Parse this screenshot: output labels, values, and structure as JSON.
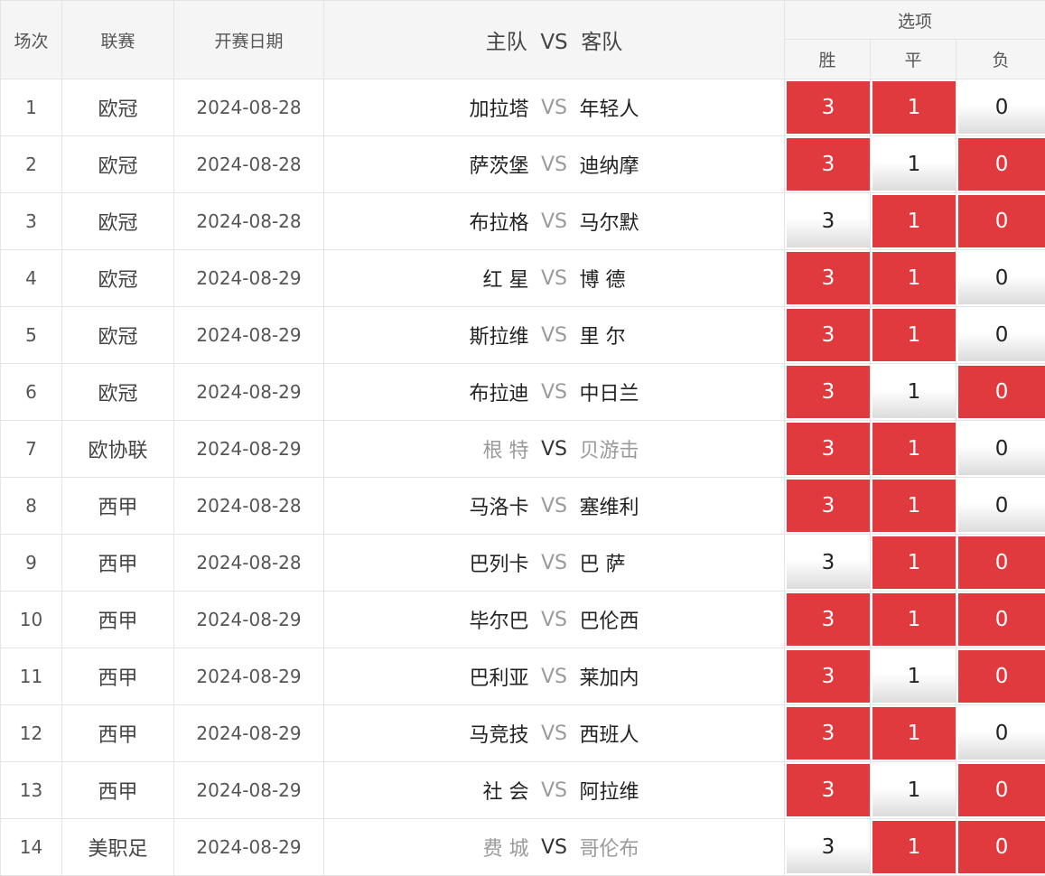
{
  "header": {
    "idx": "场次",
    "league": "联赛",
    "date": "开赛日期",
    "match_home": "主队",
    "match_vs": "VS",
    "match_away": "客队",
    "options": "选项",
    "opt_win": "胜",
    "opt_draw": "平",
    "opt_loss": "负"
  },
  "colors": {
    "selected": "#e0393e",
    "unselected": "#ffffff"
  },
  "rows": [
    {
      "idx": "1",
      "league": "欧冠",
      "date": "2024-08-28",
      "home": "加拉塔",
      "vs": "VS",
      "away": "年轻人",
      "dim": false,
      "win": "3",
      "draw": "1",
      "loss": "0",
      "sel": [
        true,
        true,
        false
      ]
    },
    {
      "idx": "2",
      "league": "欧冠",
      "date": "2024-08-28",
      "home": "萨茨堡",
      "vs": "VS",
      "away": "迪纳摩",
      "dim": false,
      "win": "3",
      "draw": "1",
      "loss": "0",
      "sel": [
        true,
        false,
        true
      ]
    },
    {
      "idx": "3",
      "league": "欧冠",
      "date": "2024-08-28",
      "home": "布拉格",
      "vs": "VS",
      "away": "马尔默",
      "dim": false,
      "win": "3",
      "draw": "1",
      "loss": "0",
      "sel": [
        false,
        true,
        true
      ]
    },
    {
      "idx": "4",
      "league": "欧冠",
      "date": "2024-08-29",
      "home": "红 星",
      "vs": "VS",
      "away": "博 德",
      "dim": false,
      "win": "3",
      "draw": "1",
      "loss": "0",
      "sel": [
        true,
        true,
        false
      ]
    },
    {
      "idx": "5",
      "league": "欧冠",
      "date": "2024-08-29",
      "home": "斯拉维",
      "vs": "VS",
      "away": "里 尔",
      "dim": false,
      "win": "3",
      "draw": "1",
      "loss": "0",
      "sel": [
        true,
        true,
        false
      ]
    },
    {
      "idx": "6",
      "league": "欧冠",
      "date": "2024-08-29",
      "home": "布拉迪",
      "vs": "VS",
      "away": "中日兰",
      "dim": false,
      "win": "3",
      "draw": "1",
      "loss": "0",
      "sel": [
        true,
        false,
        true
      ]
    },
    {
      "idx": "7",
      "league": "欧协联",
      "date": "2024-08-29",
      "home": "根 特",
      "vs": "VS",
      "away": "贝游击",
      "dim": true,
      "win": "3",
      "draw": "1",
      "loss": "0",
      "sel": [
        true,
        true,
        false
      ]
    },
    {
      "idx": "8",
      "league": "西甲",
      "date": "2024-08-28",
      "home": "马洛卡",
      "vs": "VS",
      "away": "塞维利",
      "dim": false,
      "win": "3",
      "draw": "1",
      "loss": "0",
      "sel": [
        true,
        true,
        false
      ]
    },
    {
      "idx": "9",
      "league": "西甲",
      "date": "2024-08-28",
      "home": "巴列卡",
      "vs": "VS",
      "away": "巴 萨",
      "dim": false,
      "win": "3",
      "draw": "1",
      "loss": "0",
      "sel": [
        false,
        true,
        true
      ]
    },
    {
      "idx": "10",
      "league": "西甲",
      "date": "2024-08-29",
      "home": "毕尔巴",
      "vs": "VS",
      "away": "巴伦西",
      "dim": false,
      "win": "3",
      "draw": "1",
      "loss": "0",
      "sel": [
        true,
        true,
        true
      ]
    },
    {
      "idx": "11",
      "league": "西甲",
      "date": "2024-08-29",
      "home": "巴利亚",
      "vs": "VS",
      "away": "莱加内",
      "dim": false,
      "win": "3",
      "draw": "1",
      "loss": "0",
      "sel": [
        true,
        false,
        true
      ]
    },
    {
      "idx": "12",
      "league": "西甲",
      "date": "2024-08-29",
      "home": "马竞技",
      "vs": "VS",
      "away": "西班人",
      "dim": false,
      "win": "3",
      "draw": "1",
      "loss": "0",
      "sel": [
        true,
        true,
        false
      ]
    },
    {
      "idx": "13",
      "league": "西甲",
      "date": "2024-08-29",
      "home": "社 会",
      "vs": "VS",
      "away": "阿拉维",
      "dim": false,
      "win": "3",
      "draw": "1",
      "loss": "0",
      "sel": [
        true,
        false,
        true
      ]
    },
    {
      "idx": "14",
      "league": "美职足",
      "date": "2024-08-29",
      "home": "费 城",
      "vs": "VS",
      "away": "哥伦布",
      "dim": true,
      "win": "3",
      "draw": "1",
      "loss": "0",
      "sel": [
        false,
        true,
        true
      ]
    }
  ]
}
